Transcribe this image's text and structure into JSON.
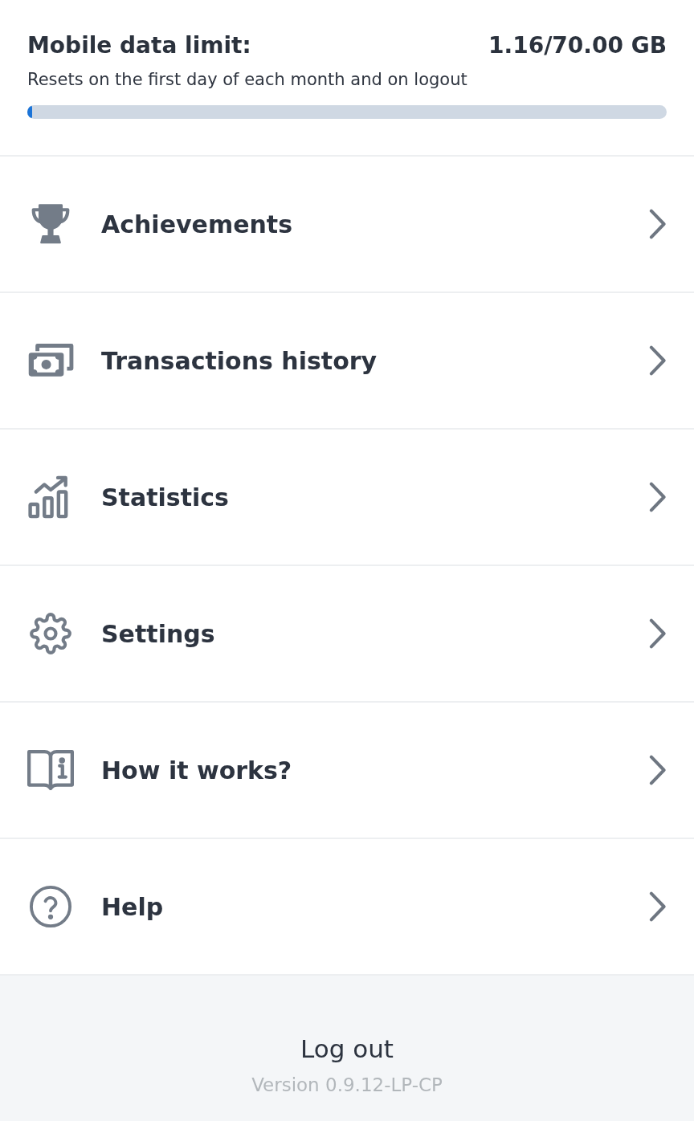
{
  "data_limit": {
    "title": "Mobile data limit:",
    "usage": "1.16/70.00 GB",
    "note": "Resets on the first day of each month and on logout",
    "level": 0.008
  },
  "menu": [
    {
      "label": "Achievements"
    },
    {
      "label": "Transactions history"
    },
    {
      "label": "Statistics"
    },
    {
      "label": "Settings"
    },
    {
      "label": "How it works?"
    },
    {
      "label": "Help"
    }
  ],
  "footer": {
    "logout": "Log out",
    "version": "Version 0.9.12-LP-CP"
  }
}
